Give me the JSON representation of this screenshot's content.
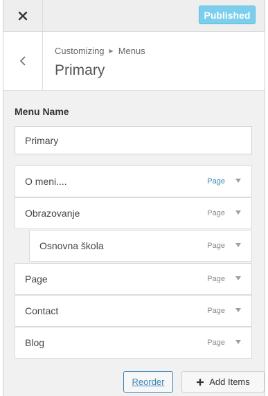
{
  "topbar": {
    "close_icon": "close-icon",
    "publish_label": "Published",
    "accent": "#7ccfec"
  },
  "header": {
    "back_icon": "chevron-left-icon",
    "breadcrumb": {
      "root": "Customizing",
      "current": "Menus"
    },
    "title": "Primary"
  },
  "menu_name": {
    "label": "Menu Name",
    "value": "Primary",
    "placeholder": ""
  },
  "menu_items": [
    {
      "label": "O meni....",
      "type": "Page",
      "child": false
    },
    {
      "label": "Obrazovanje",
      "type": "Page",
      "child": false
    },
    {
      "label": "Osnovna škola",
      "type": "Page",
      "child": true
    },
    {
      "label": "Page",
      "type": "Page",
      "child": false
    },
    {
      "label": "Contact",
      "type": "Page",
      "child": false
    },
    {
      "label": "Blog",
      "type": "Page",
      "child": false
    }
  ],
  "actions": {
    "reorder_label": "Reorder",
    "add_items_label": "Add Items",
    "add_icon": "plus-icon"
  }
}
